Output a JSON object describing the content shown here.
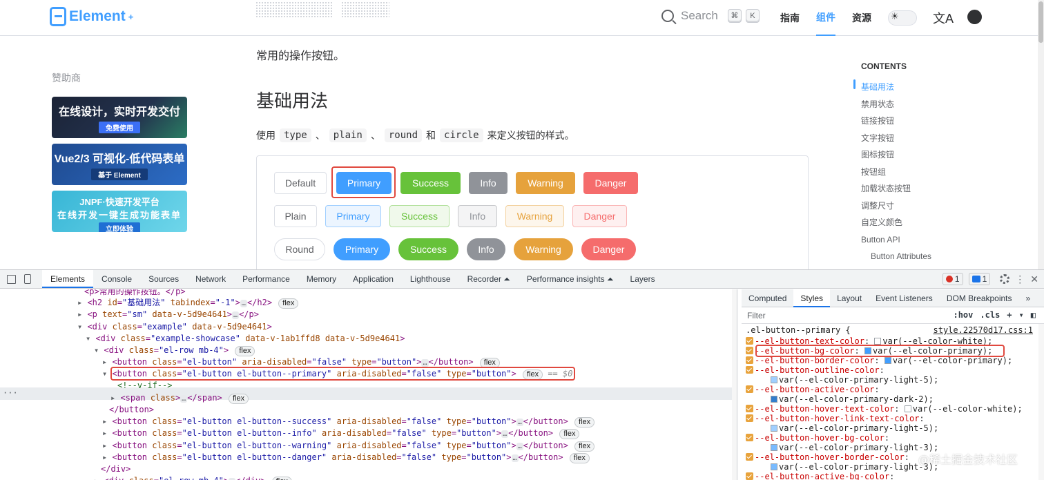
{
  "nav": {
    "logo_text": "Element",
    "logo_sup": "+",
    "search_label": "Search",
    "kbd_cmd": "⌘",
    "kbd_k": "K",
    "links": [
      "指南",
      "组件",
      "资源"
    ],
    "active_link": "组件"
  },
  "sidebar": {
    "sponsor_title": "赞助商",
    "ads": [
      {
        "line1": "在线设计，实时开发交付",
        "line2": "免费使用"
      },
      {
        "line1": "Vue2/3 可视化-低代码表单",
        "line2": "基于 Element"
      },
      {
        "line1": "JNPF·快速开发平台",
        "line1b": "在线开发一键生成功能表单",
        "line2": "立即体验"
      }
    ]
  },
  "main": {
    "intro": "常用的操作按钮。",
    "heading": "基础用法",
    "desc_parts": [
      "使用",
      "type",
      "、",
      "plain",
      "、",
      "round",
      "和",
      "circle",
      "来定义按钮的样式。"
    ],
    "rows": [
      [
        "Default",
        "Primary",
        "Success",
        "Info",
        "Warning",
        "Danger"
      ],
      [
        "Plain",
        "Primary",
        "Success",
        "Info",
        "Warning",
        "Danger"
      ],
      [
        "Round",
        "Primary",
        "Success",
        "Info",
        "Warning",
        "Danger"
      ]
    ]
  },
  "toc": {
    "title": "CONTENTS",
    "items": [
      "基础用法",
      "禁用状态",
      "链接按钮",
      "文字按钮",
      "图标按钮",
      "按钮组",
      "加载状态按钮",
      "调整尺寸",
      "自定义颜色",
      "Button API"
    ],
    "sub_items": [
      "Button Attributes"
    ]
  },
  "devtools": {
    "tabs": [
      "Elements",
      "Console",
      "Sources",
      "Network",
      "Performance",
      "Memory",
      "Application",
      "Lighthouse",
      "Recorder ⏶",
      "Performance insights ⏶",
      "Layers"
    ],
    "error_count": "1",
    "message_count": "1",
    "elements": {
      "line0": "<p>常用的操作按钮。</p>",
      "h2_id": "\"基础用法\"",
      "h2_tabindex": "\"-1\"",
      "p_text": "\"sm\"",
      "data_v": "data-v-5d9e4641",
      "div_example": "\"example\"",
      "div_showcase": "\"example-showcase\"",
      "showcase_attrs": "data-v-1ab1ffd8 data-v-5d9e4641",
      "row_class": "\"el-row mb-4\"",
      "btn_default": "\"el-button\"",
      "btn_primary": "\"el-button el-button--primary\"",
      "btn_success": "\"el-button el-button--success\"",
      "btn_info": "\"el-button el-button--info\"",
      "btn_warning": "\"el-button el-button--warning\"",
      "btn_danger": "\"el-button el-button--danger\"",
      "aria": "\"false\"",
      "type": "\"button\"",
      "comment": "<!--v-if-->",
      "span_class": "<span class>",
      "eq": "== $0",
      "flex": "flex",
      "close_button": "</button>",
      "close_div": "</div>"
    },
    "styles": {
      "tabs": [
        "Computed",
        "Styles",
        "Layout",
        "Event Listeners",
        "DOM Breakpoints",
        "»"
      ],
      "active_tab": "Styles",
      "filter_placeholder": "Filter",
      "hov": ":hov",
      "cls": ".cls",
      "selector": ".el-button--primary {",
      "source": "style.22570d17.css:1",
      "decls": [
        {
          "name": "--el-button-text-color",
          "swatch": "#ffffff",
          "value": "var(--el-color-white);"
        },
        {
          "name": "--el-button-bg-color",
          "swatch": "#409eff",
          "value": "var(--el-color-primary);"
        },
        {
          "name": "--el-button-border-color",
          "swatch": "#409eff",
          "value": "var(--el-color-primary);"
        },
        {
          "name": "--el-button-outline-color",
          "swatch": "#a0cfff",
          "value": "var(--el-color-primary-light-5);"
        },
        {
          "name": "--el-button-active-color",
          "swatch": "#337ecc",
          "value": "var(--el-color-primary-dark-2);"
        },
        {
          "name": "--el-button-hover-text-color",
          "swatch": "#ffffff",
          "value": "var(--el-color-white);"
        },
        {
          "name": "--el-button-hover-link-text-color",
          "swatch": "#a0cfff",
          "value": "var(--el-color-primary-light-5);"
        },
        {
          "name": "--el-button-hover-bg-color",
          "swatch": "#79bbff",
          "value": "var(--el-color-primary-light-3);"
        },
        {
          "name": "--el-button-hover-border-color",
          "swatch": "#79bbff",
          "value": "var(--el-color-primary-light-3);"
        },
        {
          "name": "--el-button-active-bg-color",
          "swatch": "#337ecc",
          "value": ""
        }
      ]
    }
  },
  "watermark": "@稀土掘金技术社区",
  "colors": {
    "primary": "#409eff",
    "success": "#67c23a",
    "info": "#909399",
    "warning": "#e6a23c",
    "danger": "#f56c6c",
    "highlight": "#e0483e"
  }
}
